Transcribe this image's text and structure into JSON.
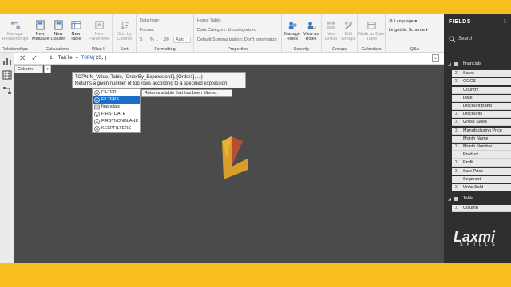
{
  "ribbon": {
    "groups": {
      "relationships": "Relationships",
      "calculations": "Calculations",
      "what_if": "What If",
      "sort": "Sort",
      "formatting": "Formatting",
      "properties": "Properties",
      "security": "Security",
      "groups": "Groups",
      "calendars": "Calendars",
      "qa": "Q&A"
    },
    "buttons": {
      "manage_relationships": "Manage Relationships",
      "new_measure": "New Measure",
      "new_column": "New Column",
      "new_table": "New Table",
      "new_parameter": "New Parameter",
      "sort_by_column": "Sort by Column",
      "manage_roles": "Manage Roles",
      "view_as_roles": "View as Roles",
      "new_group": "New Group",
      "edit_groups": "Edit Groups",
      "mark_as_date_table": "Mark as Date Table",
      "language": "Language",
      "linguistic_schema": "Linguistic Schema"
    },
    "formatting": {
      "data_type": "Data type:",
      "format": "Format:",
      "currency": "$",
      "percent": "%",
      "comma": ",",
      "decimals": ".00",
      "auto": "Auto"
    },
    "properties": {
      "home_table": "Home Table:",
      "data_category": "Data Category: Uncategorized",
      "default_summarization": "Default Summarization: Don't summarize"
    }
  },
  "formula_bar": {
    "line_number": "1",
    "prefix": "Table = ",
    "function": "TOPN(",
    "args": "20,)"
  },
  "tooltip": {
    "signature": "TOPN(N_Value, Table, [OrderBy_Expression1], [Order1], ...)",
    "description": "Returns a given number of top rows according to a specified expression."
  },
  "autocomplete": {
    "items": [
      "FILTER",
      "FILTERS",
      "financials",
      "FIRSTDATE",
      "FIRSTNONBLANK",
      "KEEPFILTERS"
    ],
    "selected_hint": "Returns a table that has been filtered."
  },
  "canvas": {
    "column_header": "Column"
  },
  "fields": {
    "title": "FIELDS",
    "search_placeholder": "Search",
    "tables": [
      {
        "name": "financials",
        "fields": [
          "Sales",
          "COGS",
          "Country",
          "Date",
          "Discount Band",
          "Discounts",
          "Gross Sales",
          "Manufacturing Price",
          "Month Name",
          "Month Number",
          "Product",
          "Profit",
          "Sale Price",
          "Segment",
          "Units Sold"
        ]
      },
      {
        "name": "Table",
        "fields": [
          "Column"
        ]
      }
    ]
  },
  "watermark": {
    "brand": "Laxmi",
    "sub": "SKILLS"
  },
  "colors": {
    "frame": "#f7be1e",
    "canvas": "#4b4b4b",
    "fields_pane": "#2f2f2f",
    "selection": "#1c6ec6",
    "logo": "#e8a628"
  }
}
